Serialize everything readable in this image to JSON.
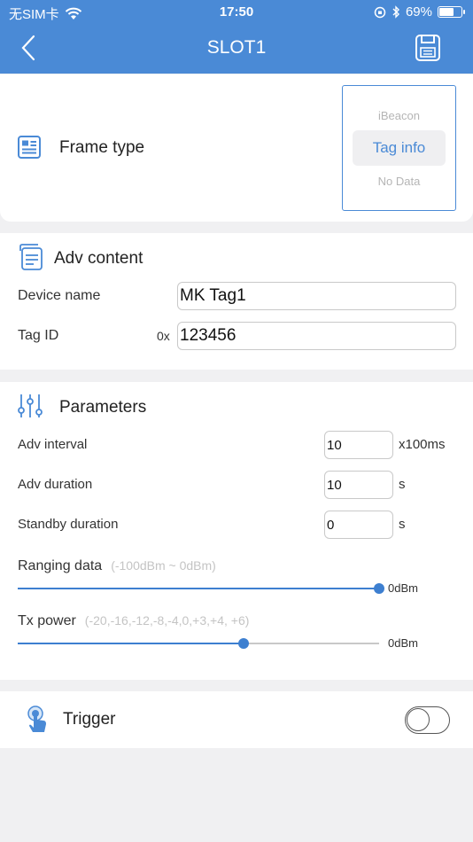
{
  "status_bar": {
    "carrier": "无SIM卡",
    "time": "17:50",
    "battery_percent": "69%",
    "battery_level": 0.69
  },
  "nav": {
    "title": "SLOT1"
  },
  "frame_type": {
    "title": "Frame type",
    "options": [
      "iBeacon",
      "Tag info",
      "No Data"
    ],
    "selected": "Tag info"
  },
  "adv_content": {
    "title": "Adv content",
    "device_name_label": "Device name",
    "device_name_value": "MK Tag1",
    "tag_id_label": "Tag ID",
    "tag_id_prefix": "0x",
    "tag_id_value": "123456"
  },
  "parameters": {
    "title": "Parameters",
    "adv_interval_label": "Adv interval",
    "adv_interval_value": "10",
    "adv_interval_unit": "x100ms",
    "adv_duration_label": "Adv duration",
    "adv_duration_value": "10",
    "adv_duration_unit": "s",
    "standby_duration_label": "Standby duration",
    "standby_duration_value": "0",
    "standby_duration_unit": "s",
    "ranging_label": "Ranging data",
    "ranging_hint": "(-100dBm ~ 0dBm)",
    "ranging_value": "0dBm",
    "ranging_level": 1.0,
    "tx_label": "Tx power",
    "tx_hint": "(-20,-16,-12,-8,-4,0,+3,+4,  +6)",
    "tx_value": "0dBm",
    "tx_level": 0.625
  },
  "trigger": {
    "title": "Trigger",
    "enabled": false
  },
  "colors": {
    "accent": "#4a8ad6",
    "background": "#f0f0f2"
  }
}
